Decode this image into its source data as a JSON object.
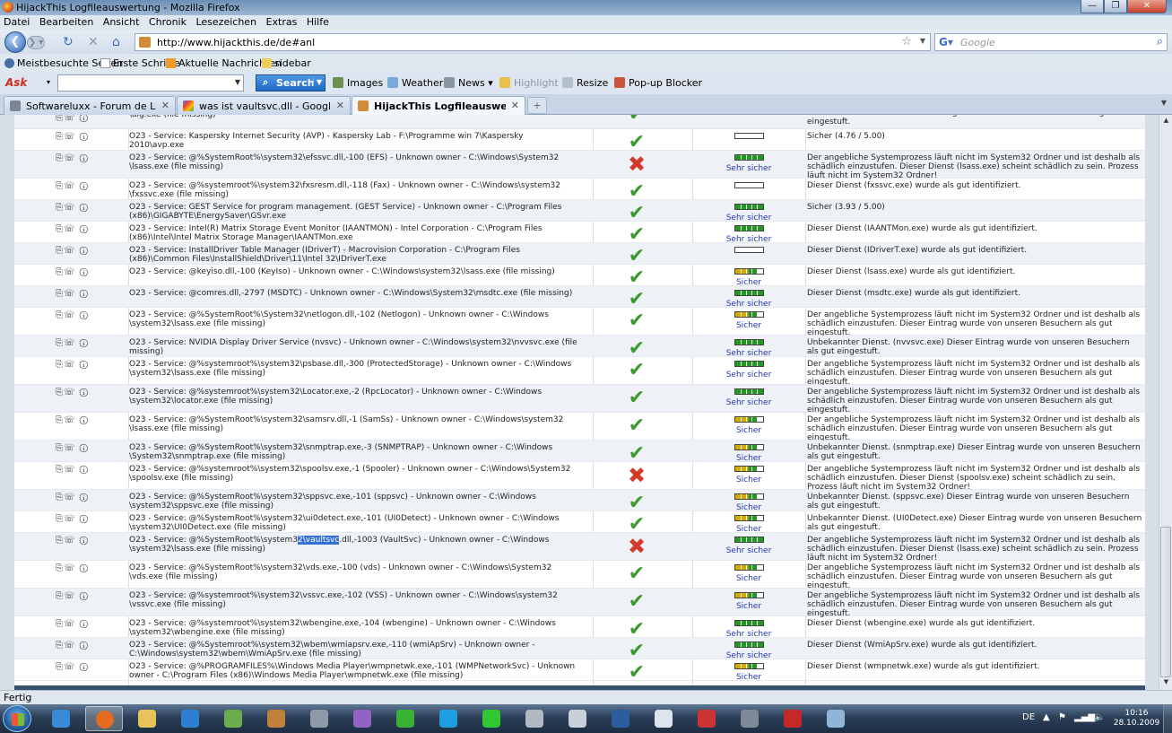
{
  "window": {
    "title": "HijackThis Logfileauswertung - Mozilla Firefox",
    "minimize": "—",
    "maximize": "❐",
    "close": "✕"
  },
  "menu": [
    "Datei",
    "Bearbeiten",
    "Ansicht",
    "Chronik",
    "Lesezeichen",
    "Extras",
    "Hilfe"
  ],
  "nav": {
    "url": "http://www.hijackthis.de/de#anl",
    "search_placeholder": "Google"
  },
  "bookmarks": [
    {
      "label": "Meistbesuchte Seiten",
      "icon": "gear-icon"
    },
    {
      "label": "Erste Schritte",
      "icon": "page-icon"
    },
    {
      "label": "Aktuelle Nachrichten",
      "icon": "rss-icon"
    },
    {
      "label": "sidebar",
      "icon": "folder-icon"
    }
  ],
  "ask_toolbar": {
    "logo": "Ask",
    "search_label": "Search",
    "buttons": [
      {
        "label": "Images",
        "icon": "images-icon",
        "disabled": false
      },
      {
        "label": "Weather",
        "icon": "weather-icon",
        "disabled": false
      },
      {
        "label": "News",
        "icon": "news-icon",
        "disabled": false
      },
      {
        "label": "Highlight",
        "icon": "highlight-icon",
        "disabled": true
      },
      {
        "label": "Resize",
        "icon": "resize-icon",
        "disabled": false
      },
      {
        "label": "Pop-up Blocker",
        "icon": "popup-blocker-icon",
        "disabled": false
      }
    ]
  },
  "tabs": [
    {
      "label": "Softwareluxx - Forum de Luxx",
      "active": false
    },
    {
      "label": "was ist vaultsvc.dll - Google-Suche",
      "active": false
    },
    {
      "label": "HijackThis Logfileauswertung",
      "active": true
    }
  ],
  "rows": [
    {
      "entry": "\\alg.exe (file missing)",
      "status": "ok",
      "rating_label": "Sicher",
      "bar": "green",
      "filled": 5,
      "desc": "schädlich einzustufen. Dieser Eintrag wurde von unseren Besuchern als gut eingestuft.",
      "partial": true
    },
    {
      "entry": "O23 - Service: Kaspersky Internet Security (AVP) - Kaspersky Lab - F:\\Programme win 7\\Kaspersky 2010\\avp.exe",
      "status": "ok",
      "rating_label": "",
      "bar": "empty",
      "filled": 0,
      "desc": "Sicher (4.76 / 5.00)"
    },
    {
      "entry": "O23 - Service: @%SystemRoot%\\system32\\efssvc.dll,-100 (EFS) - Unknown owner - C:\\Windows\\System32 \\lsass.exe (file missing)",
      "status": "bad",
      "rating_label": "Sehr sicher",
      "bar": "green",
      "filled": 5,
      "desc": "Der angebliche Systemprozess läuft nicht im System32 Ordner und ist deshalb als schädlich einzustufen. Dieser Dienst (lsass.exe) scheint schädlich zu sein. Prozess läuft nicht im System32 Ordner!"
    },
    {
      "entry": "O23 - Service: @%systemroot%\\system32\\fxsresm.dll,-118 (Fax) - Unknown owner - C:\\Windows\\system32 \\fxssvc.exe (file missing)",
      "status": "ok",
      "rating_label": "",
      "bar": "empty",
      "filled": 0,
      "desc": "Dieser Dienst (fxssvc.exe) wurde als gut identifiziert."
    },
    {
      "entry": "O23 - Service: GEST Service for program management. (GEST Service) - Unknown owner - C:\\Program Files (x86)\\GIGABYTE\\EnergySaver\\GSvr.exe",
      "status": "ok",
      "rating_label": "Sehr sicher",
      "bar": "green",
      "filled": 5,
      "desc": "Sicher (3.93 / 5.00)"
    },
    {
      "entry": "O23 - Service: Intel(R) Matrix Storage Event Monitor (IAANTMON) - Intel Corporation - C:\\Program Files (x86)\\Intel\\Intel Matrix Storage Manager\\IAANTMon.exe",
      "status": "ok",
      "rating_label": "Sehr sicher",
      "bar": "green",
      "filled": 5,
      "desc": "Dieser Dienst (IAANTMon.exe) wurde als gut identifiziert."
    },
    {
      "entry": "O23 - Service: InstallDriver Table Manager (IDriverT) - Macrovision Corporation - C:\\Program Files (x86)\\Common Files\\InstallShield\\Driver\\11\\Intel 32\\IDriverT.exe",
      "status": "ok",
      "rating_label": "",
      "bar": "empty",
      "filled": 0,
      "desc": "Dieser Dienst (IDriverT.exe) wurde als gut identifiziert."
    },
    {
      "entry": "O23 - Service: @keyiso.dll,-100 (KeyIso) - Unknown owner - C:\\Windows\\system32\\lsass.exe (file missing)",
      "status": "ok",
      "rating_label": "Sicher",
      "bar": "yellow",
      "filled": 4,
      "desc": "Dieser Dienst (lsass.exe) wurde als gut identifiziert."
    },
    {
      "entry": "O23 - Service: @comres.dll,-2797 (MSDTC) - Unknown owner - C:\\Windows\\System32\\msdtc.exe (file missing)",
      "status": "ok",
      "rating_label": "Sehr sicher",
      "bar": "green",
      "filled": 5,
      "desc": "Dieser Dienst (msdtc.exe) wurde als gut identifiziert."
    },
    {
      "entry": "O23 - Service: @%SystemRoot%\\System32\\netlogon.dll,-102 (Netlogon) - Unknown owner - C:\\Windows \\system32\\lsass.exe (file missing)",
      "status": "ok",
      "rating_label": "Sicher",
      "bar": "yellow",
      "filled": 4,
      "desc": "Der angebliche Systemprozess läuft nicht im System32 Ordner und ist deshalb als schädlich einzustufen. Dieser Eintrag wurde von unseren Besuchern als gut eingestuft."
    },
    {
      "entry": "O23 - Service: NVIDIA Display Driver Service (nvsvc) - Unknown owner - C:\\Windows\\system32\\nvvsvc.exe (file missing)",
      "status": "ok",
      "rating_label": "Sehr sicher",
      "bar": "green",
      "filled": 5,
      "desc": "Unbekannter Dienst. (nvvsvc.exe) Dieser Eintrag wurde von unseren Besuchern als gut eingestuft."
    },
    {
      "entry": "O23 - Service: @%systemroot%\\system32\\psbase.dll,-300 (ProtectedStorage) - Unknown owner - C:\\Windows \\system32\\lsass.exe (file missing)",
      "status": "ok",
      "rating_label": "Sehr sicher",
      "bar": "green",
      "filled": 5,
      "desc": "Der angebliche Systemprozess läuft nicht im System32 Ordner und ist deshalb als schädlich einzustufen. Dieser Eintrag wurde von unseren Besuchern als gut eingestuft."
    },
    {
      "entry": "O23 - Service: @%systemroot%\\system32\\Locator.exe,-2 (RpcLocator) - Unknown owner - C:\\Windows \\system32\\locator.exe (file missing)",
      "status": "ok",
      "rating_label": "Sehr sicher",
      "bar": "green",
      "filled": 5,
      "desc": "Der angebliche Systemprozess läuft nicht im System32 Ordner und ist deshalb als schädlich einzustufen. Dieser Eintrag wurde von unseren Besuchern als gut eingestuft."
    },
    {
      "entry": "O23 - Service: @%SystemRoot%\\system32\\samsrv.dll,-1 (SamSs) - Unknown owner - C:\\Windows\\system32 \\lsass.exe (file missing)",
      "status": "ok",
      "rating_label": "Sicher",
      "bar": "yellow",
      "filled": 4,
      "desc": "Der angebliche Systemprozess läuft nicht im System32 Ordner und ist deshalb als schädlich einzustufen. Dieser Eintrag wurde von unseren Besuchern als gut eingestuft."
    },
    {
      "entry": "O23 - Service: @%SystemRoot%\\system32\\snmptrap.exe,-3 (SNMPTRAP) - Unknown owner - C:\\Windows \\System32\\snmptrap.exe (file missing)",
      "status": "ok",
      "rating_label": "Sicher",
      "bar": "yellow",
      "filled": 4,
      "desc": "Unbekannter Dienst. (snmptrap.exe) Dieser Eintrag wurde von unseren Besuchern als gut eingestuft."
    },
    {
      "entry": "O23 - Service: @%systemroot%\\system32\\spoolsv.exe,-1 (Spooler) - Unknown owner - C:\\Windows\\System32 \\spoolsv.exe (file missing)",
      "status": "bad",
      "rating_label": "Sicher",
      "bar": "yellow",
      "filled": 4,
      "desc": "Der angebliche Systemprozess läuft nicht im System32 Ordner und ist deshalb als schädlich einzustufen. Dieser Dienst (spoolsv.exe) scheint schädlich zu sein. Prozess läuft nicht im System32 Ordner!"
    },
    {
      "entry": "O23 - Service: @%SystemRoot%\\system32\\sppsvc.exe,-101 (sppsvc) - Unknown owner - C:\\Windows \\system32\\sppsvc.exe (file missing)",
      "status": "ok",
      "rating_label": "Sicher",
      "bar": "yellow",
      "filled": 4,
      "desc": "Unbekannter Dienst. (sppsvc.exe) Dieser Eintrag wurde von unseren Besuchern als gut eingestuft."
    },
    {
      "entry": "O23 - Service: @%SystemRoot%\\system32\\ui0detect.exe,-101 (UI0Detect) - Unknown owner - C:\\Windows \\system32\\UI0Detect.exe (file missing)",
      "status": "ok",
      "rating_label": "Sicher",
      "bar": "yellow",
      "filled": 4,
      "desc": "Unbekannter Dienst. (UI0Detect.exe) Dieser Eintrag wurde von unseren Besuchern als gut eingestuft."
    },
    {
      "entry_pre": "O23 - Service: @%SystemRoot%\\system3",
      "entry_hl": "2\\vaultsvc",
      "entry_post": ".dll,-1003 (VaultSvc) - Unknown owner - C:\\Windows \\system32\\lsass.exe (file missing)",
      "status": "bad",
      "rating_label": "Sehr sicher",
      "bar": "green",
      "filled": 5,
      "desc": "Der angebliche Systemprozess läuft nicht im System32 Ordner und ist deshalb als schädlich einzustufen. Dieser Dienst (lsass.exe) scheint schädlich zu sein. Prozess läuft nicht im System32 Ordner!"
    },
    {
      "entry": "O23 - Service: @%SystemRoot%\\system32\\vds.exe,-100 (vds) - Unknown owner - C:\\Windows\\System32 \\vds.exe (file missing)",
      "status": "ok",
      "rating_label": "Sicher",
      "bar": "yellow",
      "filled": 4,
      "desc": "Der angebliche Systemprozess läuft nicht im System32 Ordner und ist deshalb als schädlich einzustufen. Dieser Eintrag wurde von unseren Besuchern als gut eingestuft."
    },
    {
      "entry": "O23 - Service: @%systemroot%\\system32\\vssvc.exe,-102 (VSS) - Unknown owner - C:\\Windows\\system32 \\vssvc.exe (file missing)",
      "status": "ok",
      "rating_label": "Sicher",
      "bar": "yellow",
      "filled": 4,
      "desc": "Der angebliche Systemprozess läuft nicht im System32 Ordner und ist deshalb als schädlich einzustufen. Dieser Eintrag wurde von unseren Besuchern als gut eingestuft."
    },
    {
      "entry": "O23 - Service: @%systemroot%\\system32\\wbengine.exe,-104 (wbengine) - Unknown owner - C:\\Windows \\system32\\wbengine.exe (file missing)",
      "status": "ok",
      "rating_label": "Sehr sicher",
      "bar": "green",
      "filled": 5,
      "desc": "Dieser Dienst (wbengine.exe) wurde als gut identifiziert."
    },
    {
      "entry": "O23 - Service: @%Systemroot%\\system32\\wbem\\wmiapsrv.exe,-110 (wmiApSrv) - Unknown owner - C:\\Windows\\system32\\wbem\\WmiApSrv.exe (file missing)",
      "status": "ok",
      "rating_label": "Sehr sicher",
      "bar": "green",
      "filled": 5,
      "desc": "Dieser Dienst (WmiApSrv.exe) wurde als gut identifiziert."
    },
    {
      "entry": "O23 - Service: @%PROGRAMFILES%\\Windows Media Player\\wmpnetwk.exe,-101 (WMPNetworkSvc) - Unknown owner - C:\\Program Files (x86)\\Windows Media Player\\wmpnetwk.exe (file missing)",
      "status": "ok",
      "rating_label": "Sicher",
      "bar": "yellow",
      "filled": 4,
      "desc": "Dieser Dienst (wmpnetwk.exe) wurde als gut identifiziert."
    }
  ],
  "row_icons": "⎘☏ ⓘ",
  "status_bar": "Fertig",
  "taskbar": {
    "apps": [
      "Internet Explorer",
      "Firefox",
      "Explorer",
      "Media Player",
      "App",
      "App",
      "App",
      "App",
      "App",
      "Skype",
      "App",
      "App",
      "App",
      "App",
      "App",
      "App",
      "App",
      "Kaspersky",
      "App"
    ],
    "lang": "DE",
    "time": "10:16",
    "date": "28.10.2009"
  },
  "colors": {
    "ok": "#3c9a2e",
    "bad": "#d43a2a",
    "bar_green": "#1e9c1e",
    "bar_yellow": "#d8a900",
    "rating_label": "#2237b4",
    "highlight": "#3470d3"
  }
}
